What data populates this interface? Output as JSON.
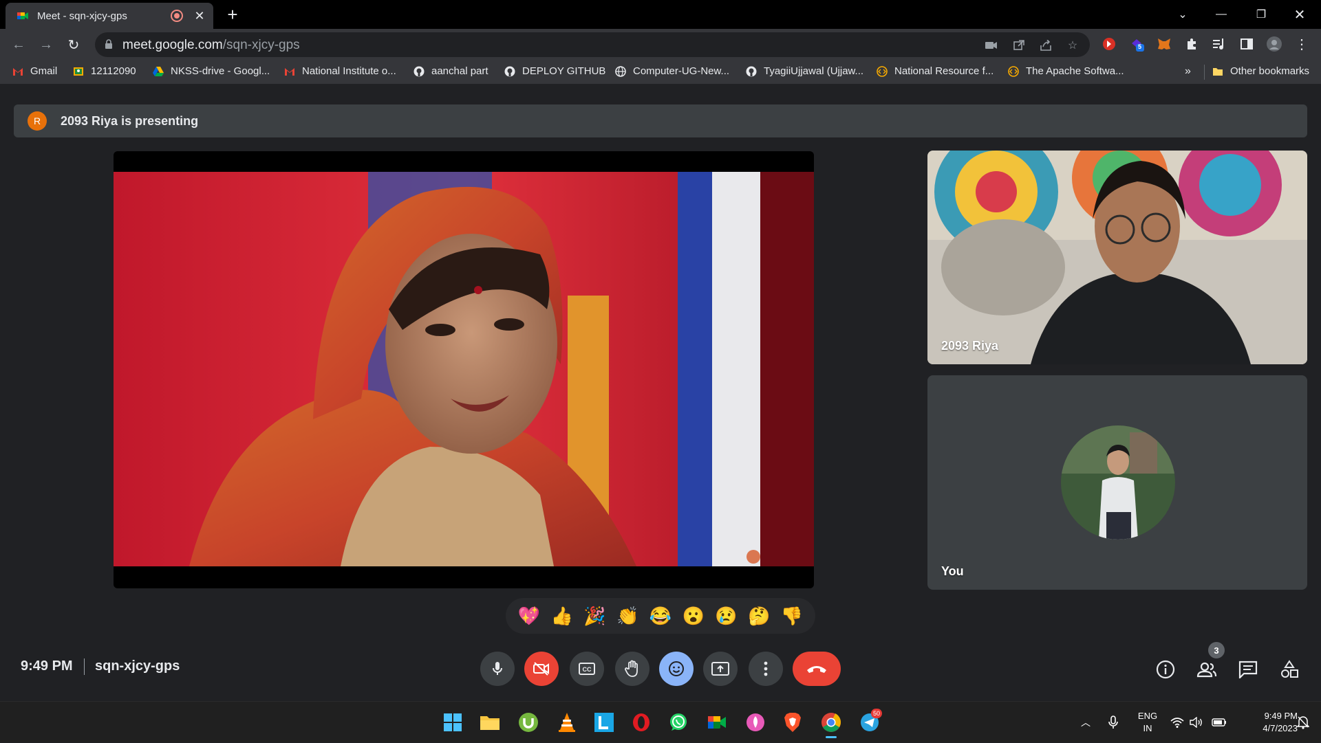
{
  "browser": {
    "tab_title": "Meet - sqn-xjcy-gps",
    "url_host": "meet.google.com",
    "url_path": "/sqn-xjcy-gps",
    "extension_badge": "5"
  },
  "bookmarks": [
    {
      "label": "Gmail",
      "icon": "gmail-icon",
      "color": "#ea4335"
    },
    {
      "label": "12112090",
      "icon": "classroom-icon",
      "color": "#f9ab00"
    },
    {
      "label": "NKSS-drive - Googl...",
      "icon": "drive-icon",
      "color": "#34a853"
    },
    {
      "label": "National Institute o...",
      "icon": "gmail-icon",
      "color": "#ea4335"
    },
    {
      "label": "aanchal part",
      "icon": "github-icon",
      "color": "#e8eaed"
    },
    {
      "label": "DEPLOY GITHUB",
      "icon": "github-icon",
      "color": "#e8eaed"
    },
    {
      "label": "Computer-UG-New...",
      "icon": "globe-icon",
      "color": "#e8eaed"
    },
    {
      "label": "TyagiiUjjawal (Ujjaw...",
      "icon": "github-icon",
      "color": "#e8eaed"
    },
    {
      "label": "National Resource f...",
      "icon": "code-icon",
      "color": "#f9ab00"
    },
    {
      "label": "The Apache Softwa...",
      "icon": "code-icon",
      "color": "#f9ab00"
    }
  ],
  "bookmarks_overflow": "»",
  "other_bookmarks": "Other bookmarks",
  "meet": {
    "presenter_initial": "R",
    "presenting_text": "2093 Riya is presenting",
    "tiles": [
      {
        "name": "2093 Riya"
      },
      {
        "name": "You"
      }
    ],
    "reactions": [
      "💖",
      "👍",
      "🎉",
      "👏",
      "😂",
      "😮",
      "😢",
      "🤔",
      "👎"
    ],
    "time": "9:49 PM",
    "separator": "|",
    "meeting_code": "sqn-xjcy-gps",
    "participants_count": "3",
    "accent_color": "#8ab4f8",
    "danger_color": "#ea4335"
  },
  "taskbar": {
    "language": "ENG",
    "region": "IN",
    "time": "9:49 PM",
    "date": "4/7/2023",
    "telegram_badge": "50"
  }
}
